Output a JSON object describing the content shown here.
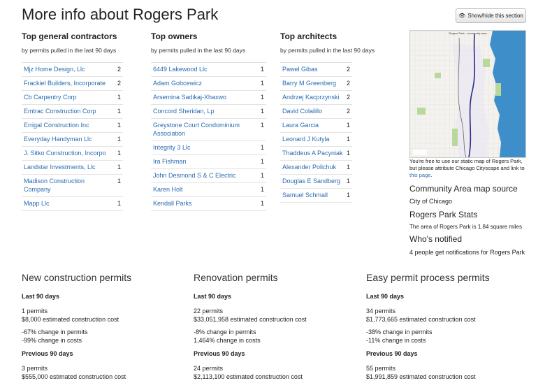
{
  "page_title": "More info about Rogers Park",
  "toggle_button": "Show/hide this section",
  "contractors": {
    "title": "Top general contractors",
    "subtitle": "by permits pulled in the last 90 days",
    "items": [
      {
        "name": "Mjz Home Design, Llc",
        "count": "2"
      },
      {
        "name": "Frackiel Builders, Incorporate",
        "count": "2"
      },
      {
        "name": "Cb Carpentry Corp",
        "count": "1"
      },
      {
        "name": "Emtrac Construction Corp",
        "count": "1"
      },
      {
        "name": "Errigal Construction Inc",
        "count": "1"
      },
      {
        "name": "Everyday Handyman Llc",
        "count": "1"
      },
      {
        "name": "J. Sitko Construction, Incorpo",
        "count": "1"
      },
      {
        "name": "Landstar Investments, Llc",
        "count": "1"
      },
      {
        "name": "Madison Construction Company",
        "count": "1"
      },
      {
        "name": "Mapp Llc",
        "count": "1"
      }
    ]
  },
  "owners": {
    "title": "Top owners",
    "subtitle": "by permits pulled in the last 90 days",
    "items": [
      {
        "name": "6449 Lakewood Llc",
        "count": "1"
      },
      {
        "name": "Adam Gobcewicz",
        "count": "1"
      },
      {
        "name": "Arsemina Sadikaj-Xhaxwo",
        "count": "1"
      },
      {
        "name": "Concord Sheridan, Lp",
        "count": "1"
      },
      {
        "name": "Greystone Court Condominium Association",
        "count": "1"
      },
      {
        "name": "Integrity 3 Llc",
        "count": "1"
      },
      {
        "name": "Ira Fishman",
        "count": "1"
      },
      {
        "name": "John Desmond S & C Electric",
        "count": "1"
      },
      {
        "name": "Karen Holt",
        "count": "1"
      },
      {
        "name": "Kendall Parks",
        "count": "1"
      }
    ]
  },
  "architects": {
    "title": "Top architects",
    "subtitle": "by permits pulled in the last 90 days",
    "items": [
      {
        "name": "Pawel Gibas",
        "count": "2"
      },
      {
        "name": "Barry M Greenberg",
        "count": "2"
      },
      {
        "name": "Andrzej Kacprzynski",
        "count": "2"
      },
      {
        "name": "David Colalillo",
        "count": "2"
      },
      {
        "name": "Laura Garcia",
        "count": "1"
      },
      {
        "name": "Leonard J Kutyla",
        "count": "1"
      },
      {
        "name": "Thaddeus A Pacyniak",
        "count": "1"
      },
      {
        "name": "Alexander Polichuk",
        "count": "1"
      },
      {
        "name": "Douglas E Sandberg",
        "count": "1"
      },
      {
        "name": "Samuel Schmall",
        "count": "1"
      }
    ]
  },
  "map": {
    "title": "Rogers Park - community area",
    "caption_pre": "You're free to use our static map of Rogers Park, but please attribute Chicago Cityscape and link to ",
    "caption_link": "this page",
    "caption_post": "."
  },
  "map_source": {
    "heading": "Community Area map source",
    "link": "City of Chicago"
  },
  "area_stats": {
    "heading": "Rogers Park Stats",
    "text": "The area of Rogers Park is 1.84 square miles"
  },
  "notified": {
    "heading": "Who's notified",
    "text": "4 people get notifications for Rogers Park"
  },
  "permit_stats": [
    {
      "title": "New construction permits",
      "last_label": "Last 90 days",
      "last_permits": "1 permits",
      "last_cost": "$8,000 estimated construction cost",
      "change_permits": "-67% change in permits",
      "change_costs": "-99% change in costs",
      "prev_label": "Previous 90 days",
      "prev_permits": "3 permits",
      "prev_cost": "$555,000 estimated construction cost"
    },
    {
      "title": "Renovation permits",
      "last_label": "Last 90 days",
      "last_permits": "22 permits",
      "last_cost": "$33,051,958 estimated construction cost",
      "change_permits": "-8% change in permits",
      "change_costs": "1,464% change in costs",
      "prev_label": "Previous 90 days",
      "prev_permits": "24 permits",
      "prev_cost": "$2,113,100 estimated construction cost"
    },
    {
      "title": "Easy permit process permits",
      "last_label": "Last 90 days",
      "last_permits": "34 permits",
      "last_cost": "$1,773,665 estimated construction cost",
      "change_permits": "-38% change in permits",
      "change_costs": "-11% change in costs",
      "prev_label": "Previous 90 days",
      "prev_permits": "55 permits",
      "prev_cost": "$1,991,859 estimated construction cost"
    }
  ],
  "colors": {
    "link": "#2a6cb0",
    "text": "#222222",
    "lake": "#3e8fc9",
    "park": "#b9d89a"
  }
}
